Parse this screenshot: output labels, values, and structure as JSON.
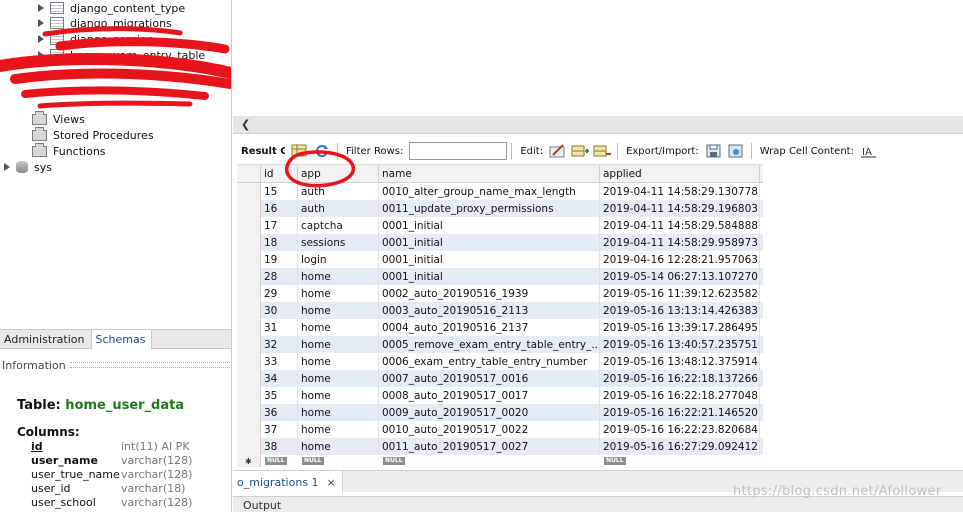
{
  "tree": {
    "tables": [
      "django_content_type",
      "django_migrations",
      "django_session",
      "home_exam_entry_table"
    ],
    "folders": [
      "Views",
      "Stored Procedures",
      "Functions"
    ],
    "schema": "sys"
  },
  "left_tabs": [
    "Administration",
    "Schemas"
  ],
  "info": {
    "header": "Information",
    "table_label": "Table:",
    "table_name": "home_user_data",
    "columns_label": "Columns:",
    "columns": [
      {
        "name": "id",
        "type": "int(11) AI PK"
      },
      {
        "name": "user_name",
        "type": "varchar(128)"
      },
      {
        "name": "user_true_name",
        "type": "varchar(128)"
      },
      {
        "name": "user_id",
        "type": "varchar(18)"
      },
      {
        "name": "user_school",
        "type": "varchar(128)"
      }
    ]
  },
  "toolbar": {
    "result_grid": "Result Grid",
    "filter_rows": "Filter Rows:",
    "filter_value": "",
    "edit": "Edit:",
    "export_import": "Export/Import:",
    "wrap_cell": "Wrap Cell Content:"
  },
  "grid": {
    "headers": [
      "id",
      "app",
      "name",
      "applied"
    ],
    "rows": [
      [
        "15",
        "auth",
        "0010_alter_group_name_max_length",
        "2019-04-11 14:58:29.130778"
      ],
      [
        "16",
        "auth",
        "0011_update_proxy_permissions",
        "2019-04-11 14:58:29.196803"
      ],
      [
        "17",
        "captcha",
        "0001_initial",
        "2019-04-11 14:58:29.584888"
      ],
      [
        "18",
        "sessions",
        "0001_initial",
        "2019-04-11 14:58:29.958973"
      ],
      [
        "19",
        "login",
        "0001_initial",
        "2019-04-16 12:28:21.957063"
      ],
      [
        "28",
        "home",
        "0001_initial",
        "2019-05-14 06:27:13.107270"
      ],
      [
        "29",
        "home",
        "0002_auto_20190516_1939",
        "2019-05-16 11:39:12.623582"
      ],
      [
        "30",
        "home",
        "0003_auto_20190516_2113",
        "2019-05-16 13:13:14.426383"
      ],
      [
        "31",
        "home",
        "0004_auto_20190516_2137",
        "2019-05-16 13:39:17.286495"
      ],
      [
        "32",
        "home",
        "0005_remove_exam_entry_table_entry_...",
        "2019-05-16 13:40:57.235751"
      ],
      [
        "33",
        "home",
        "0006_exam_entry_table_entry_number",
        "2019-05-16 13:48:12.375914"
      ],
      [
        "34",
        "home",
        "0007_auto_20190517_0016",
        "2019-05-16 16:22:18.137266"
      ],
      [
        "35",
        "home",
        "0008_auto_20190517_0017",
        "2019-05-16 16:22:18.277048"
      ],
      [
        "36",
        "home",
        "0009_auto_20190517_0020",
        "2019-05-16 16:22:21.146520"
      ],
      [
        "37",
        "home",
        "0010_auto_20190517_0022",
        "2019-05-16 16:22:23.820684"
      ],
      [
        "38",
        "home",
        "0011_auto_20190517_0027",
        "2019-05-16 16:27:29.092412"
      ]
    ],
    "null_label": "NULL"
  },
  "bottom": {
    "result_tab": "o_migrations 1",
    "close": "×",
    "output": "Output"
  },
  "watermark": "https://blog.csdn.net/Afollower",
  "colors": {
    "row_alt": "#e5ecf6",
    "scribble": "#e8141c",
    "schema_tab": "#1c4e8e",
    "table_name": "#1b7a1b"
  }
}
